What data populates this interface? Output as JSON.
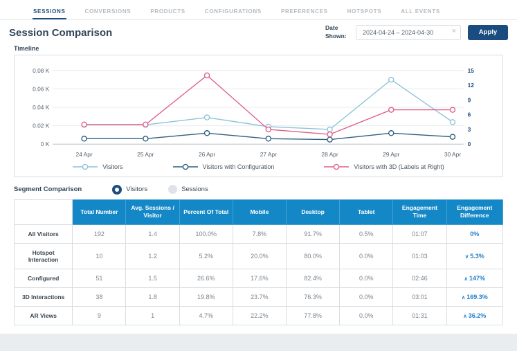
{
  "nav": {
    "tabs": [
      {
        "label": "SESSIONS",
        "active": true
      },
      {
        "label": "CONVERSIONS",
        "active": false
      },
      {
        "label": "PRODUCTS",
        "active": false
      },
      {
        "label": "CONFIGURATIONS",
        "active": false
      },
      {
        "label": "PREFERENCES",
        "active": false
      },
      {
        "label": "HOTSPOTS",
        "active": false
      },
      {
        "label": "ALL EVENTS",
        "active": false
      }
    ]
  },
  "header": {
    "title": "Session Comparison",
    "date_label": "Date Shown:",
    "date_value": "2024-04-24 – 2024-04-30",
    "clear_icon": "×",
    "apply_label": "Apply"
  },
  "timeline": {
    "label": "Timeline"
  },
  "chart_data": {
    "type": "line",
    "title": "Timeline",
    "categories": [
      "24 Apr",
      "25 Apr",
      "26 Apr",
      "27 Apr",
      "28 Apr",
      "29 Apr",
      "30 Apr"
    ],
    "left_axis": {
      "tick_labels": [
        "0 K",
        "0.02 K",
        "0.04 K",
        "0.06 K",
        "0.08 K"
      ],
      "tick_values": [
        0,
        20,
        40,
        60,
        80
      ],
      "max": 80
    },
    "right_axis": {
      "tick_labels": [
        "0",
        "3",
        "6",
        "9",
        "12",
        "15"
      ],
      "tick_values": [
        0,
        3,
        6,
        9,
        12,
        15
      ],
      "max": 15
    },
    "grid": true,
    "legend_position": "bottom",
    "series": [
      {
        "name": "Visitors",
        "axis": "left",
        "color": "#8ec2da",
        "values": [
          21,
          21,
          29,
          19,
          16,
          70,
          24
        ]
      },
      {
        "name": "Visitors with Configuration",
        "axis": "left",
        "color": "#2e5f7e",
        "values": [
          6,
          6,
          12,
          6,
          5,
          12,
          8
        ]
      },
      {
        "name": "Visitors with 3D (Labels at Right)",
        "axis": "right",
        "color": "#e0608c",
        "values": [
          4,
          4,
          14,
          3,
          2,
          7,
          7
        ]
      }
    ]
  },
  "segment": {
    "label": "Segment Comparison",
    "options": [
      {
        "label": "Visitors",
        "selected": true
      },
      {
        "label": "Sessions",
        "selected": false
      }
    ]
  },
  "table": {
    "columns": [
      "Total Number",
      "Avg. Sessions / Visitor",
      "Percent Of Total",
      "Mobile",
      "Desktop",
      "Tablet",
      "Engagement Time",
      "Engagement Difference"
    ],
    "rows": [
      {
        "label": "All Visitors",
        "cells": [
          "192",
          "1.4",
          "100.0%",
          "7.8%",
          "91.7%",
          "0.5%",
          "01:07"
        ],
        "diff": {
          "dir": "none",
          "text": "0%"
        }
      },
      {
        "label": "Hotspot Interaction",
        "cells": [
          "10",
          "1.2",
          "5.2%",
          "20.0%",
          "80.0%",
          "0.0%",
          "01:03"
        ],
        "diff": {
          "dir": "down",
          "text": "5.3%"
        }
      },
      {
        "label": "Configured",
        "cells": [
          "51",
          "1.5",
          "26.6%",
          "17.6%",
          "82.4%",
          "0.0%",
          "02:46"
        ],
        "diff": {
          "dir": "up",
          "text": "147%"
        }
      },
      {
        "label": "3D Interactions",
        "cells": [
          "38",
          "1.8",
          "19.8%",
          "23.7%",
          "76.3%",
          "0.0%",
          "03:01"
        ],
        "diff": {
          "dir": "up",
          "text": "169.3%"
        }
      },
      {
        "label": "AR Views",
        "cells": [
          "9",
          "1",
          "4.7%",
          "22.2%",
          "77.8%",
          "0.0%",
          "01:31"
        ],
        "diff": {
          "dir": "up",
          "text": "36.2%"
        }
      }
    ]
  },
  "colors": {
    "accent_navy": "#1d4e7e",
    "table_header_blue": "#1488c6",
    "diff_blue": "#2080cc",
    "apply_button_navy": "#1b4c80",
    "series_visitors": "#8ec2da",
    "series_configuration": "#2e5f7e",
    "series_3d": "#e0608c"
  }
}
